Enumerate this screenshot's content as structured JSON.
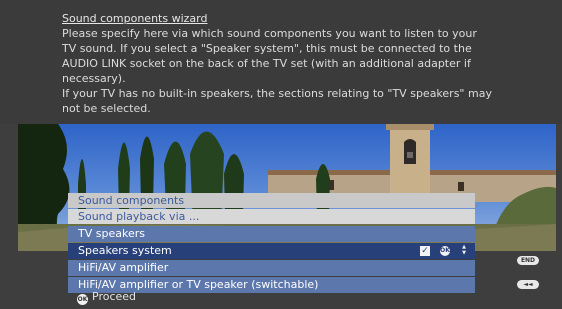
{
  "info": {
    "title": "Sound components wizard",
    "text_lines": [
      "Please specify here via which sound components you want to listen to your",
      "TV sound. If you select a \"Speaker system\", this must be connected to the",
      "AUDIO LINK socket on the back of the TV set (with an additional adapter if",
      "necessary).",
      "If your TV has no built-in speakers, the sections relating to \"TV speakers\" may",
      "not be selected."
    ]
  },
  "dialog": {
    "header1": "Sound components",
    "header2": "Sound playback via ...",
    "options": [
      {
        "label": "TV speakers",
        "selected": false
      },
      {
        "label": "Speakers system",
        "selected": true,
        "checked": true
      },
      {
        "label": "HiFi/AV amplifier",
        "selected": false
      },
      {
        "label": "HiFi/AV amplifier or TV speaker (switchable)",
        "selected": false
      }
    ],
    "check_glyph": "✓",
    "ok_badge": "OK",
    "arrows": {
      "up": "▲",
      "down": "▼"
    }
  },
  "footer": {
    "proceed_badge": "OK",
    "proceed_label": "Proceed",
    "end_key": "END",
    "back_key": "◄◄"
  },
  "colors": {
    "background": "#3b3b3b",
    "option": "#5c77ac",
    "option_selected": "#28407a",
    "header": "#c9c9c9",
    "header_text": "#3a5a9c"
  },
  "icons": [
    "check-icon",
    "ok-button-icon",
    "up-down-arrows-icon",
    "end-key-icon",
    "back-key-icon"
  ]
}
